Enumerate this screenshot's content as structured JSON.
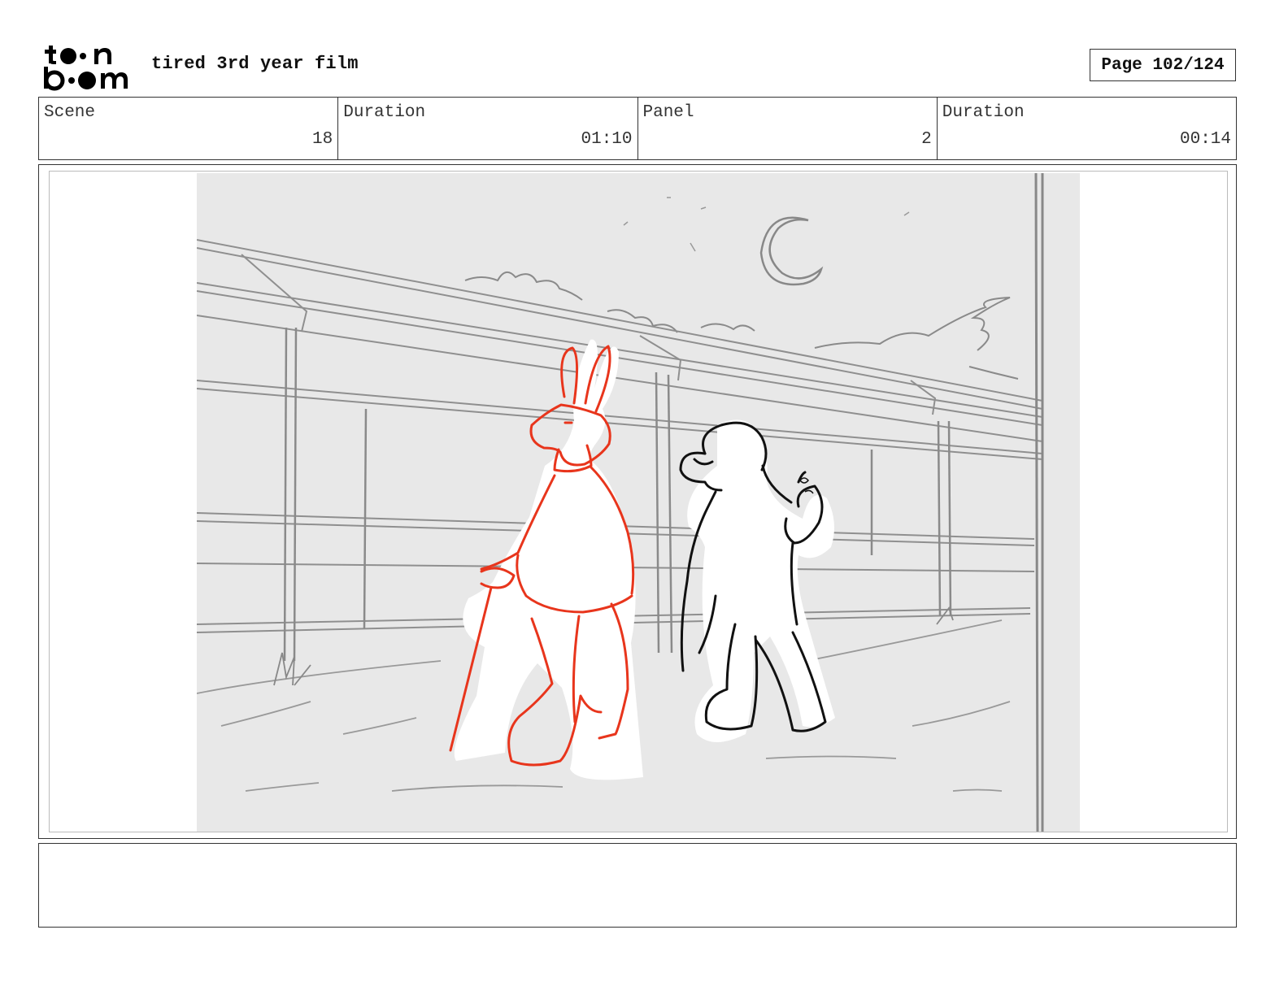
{
  "header": {
    "logo_alt": "toon boom",
    "film_title": "tired 3rd year film",
    "page_label": "Page 102/124"
  },
  "info": {
    "scene_label": "Scene",
    "scene_value": "18",
    "scene_duration_label": "Duration",
    "scene_duration_value": "01:10",
    "panel_label": "Panel",
    "panel_value": "2",
    "panel_duration_label": "Duration",
    "panel_duration_value": "00:14"
  },
  "panel": {
    "background_color": "#e8e8e8",
    "rabbit_color": "#e8351c",
    "figure_color": "#111111"
  },
  "notes": {
    "text": ""
  }
}
